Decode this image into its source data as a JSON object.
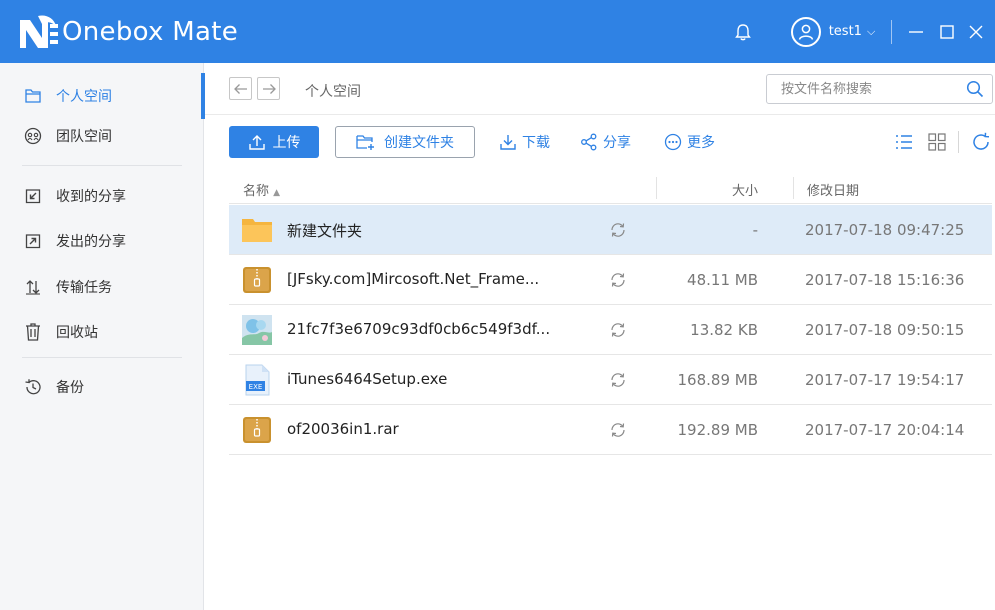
{
  "app": {
    "title": "Onebox Mate",
    "username": "test1"
  },
  "sidebar": {
    "items": [
      {
        "label": "个人空间",
        "icon": "folder-icon"
      },
      {
        "label": "团队空间",
        "icon": "team-icon"
      },
      {
        "label": "收到的分享",
        "icon": "received-share-icon"
      },
      {
        "label": "发出的分享",
        "icon": "sent-share-icon"
      },
      {
        "label": "传输任务",
        "icon": "transfer-icon"
      },
      {
        "label": "回收站",
        "icon": "trash-icon"
      },
      {
        "label": "备份",
        "icon": "backup-icon"
      }
    ],
    "active_index": 0
  },
  "address": {
    "breadcrumb": "个人空间",
    "search_placeholder": "按文件名称搜索"
  },
  "toolbar": {
    "upload": "上传",
    "new_folder": "创建文件夹",
    "download": "下载",
    "share": "分享",
    "more": "更多"
  },
  "table": {
    "headers": {
      "name": "名称",
      "size": "大小",
      "date": "修改日期"
    },
    "rows": [
      {
        "name": "新建文件夹",
        "size": "-",
        "date": "2017-07-18 09:47:25",
        "type": "folder",
        "selected": true
      },
      {
        "name": "[JFsky.com]Mircosoft.Net_Frame...",
        "size": "48.11 MB",
        "date": "2017-07-18 15:16:36",
        "type": "archive",
        "selected": false
      },
      {
        "name": "21fc7f3e6709c93df0cb6c549f3df...",
        "size": "13.82 KB",
        "date": "2017-07-18 09:50:15",
        "type": "image",
        "selected": false
      },
      {
        "name": "iTunes6464Setup.exe",
        "size": "168.89 MB",
        "date": "2017-07-17 19:54:17",
        "type": "exe",
        "selected": false
      },
      {
        "name": "of20036in1.rar",
        "size": "192.89 MB",
        "date": "2017-07-17 20:04:14",
        "type": "archive",
        "selected": false
      }
    ]
  },
  "colors": {
    "accent": "#2f82e4",
    "selected_row": "#deebf8",
    "sidebar_bg": "#f5f6f8"
  }
}
